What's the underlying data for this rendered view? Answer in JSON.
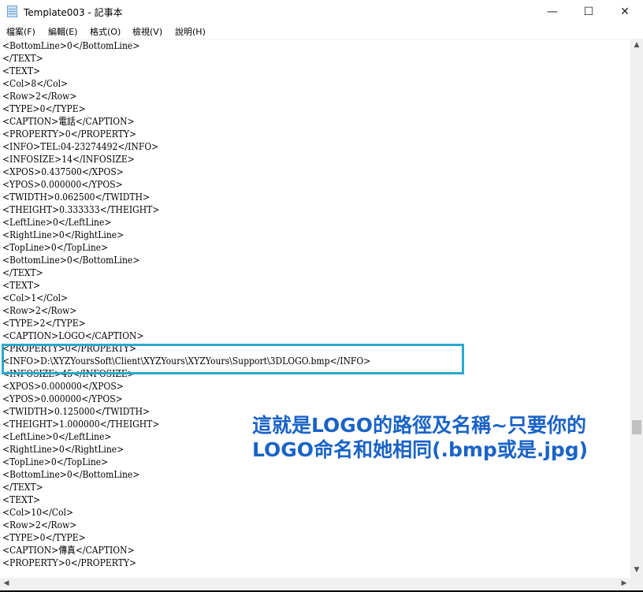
{
  "window": {
    "title": "Template003 - 記事本",
    "controls": {
      "minimize": "—",
      "maximize": "☐",
      "close": "✕"
    }
  },
  "menu": [
    "檔案(F)",
    "編輯(E)",
    "格式(O)",
    "檢視(V)",
    "說明(H)"
  ],
  "lines": [
    "<BottomLine>0</BottomLine>",
    "</TEXT>",
    "<TEXT>",
    "<Col>8</Col>",
    "<Row>2</Row>",
    "<TYPE>0</TYPE>",
    "<CAPTION>電話</CAPTION>",
    "<PROPERTY>0</PROPERTY>",
    "<INFO>TEL:04-23274492</INFO>",
    "<INFOSIZE>14</INFOSIZE>",
    "<XPOS>0.437500</XPOS>",
    "<YPOS>0.000000</YPOS>",
    "<TWIDTH>0.062500</TWIDTH>",
    "<THEIGHT>0.333333</THEIGHT>",
    "<LeftLine>0</LeftLine>",
    "<RightLine>0</RightLine>",
    "<TopLine>0</TopLine>",
    "<BottomLine>0</BottomLine>",
    "</TEXT>",
    "<TEXT>",
    "<Col>1</Col>",
    "<Row>2</Row>",
    "<TYPE>2</TYPE>",
    "<CAPTION>LOGO</CAPTION>",
    "<PROPERTY>0</PROPERTY>",
    "<INFO>D:\\XYZYoursSoft\\Client\\XYZYours\\XYZYours\\Support\\3DLOGO.bmp</INFO>",
    "<INFOSIZE>45</INFOSIZE>",
    "<XPOS>0.000000</XPOS>",
    "<YPOS>0.000000</YPOS>",
    "<TWIDTH>0.125000</TWIDTH>",
    "<THEIGHT>1.000000</THEIGHT>",
    "<LeftLine>0</LeftLine>",
    "<RightLine>0</RightLine>",
    "<TopLine>0</TopLine>",
    "<BottomLine>0</BottomLine>",
    "</TEXT>",
    "<TEXT>",
    "<Col>10</Col>",
    "<Row>2</Row>",
    "<TYPE>0</TYPE>",
    "<CAPTION>傳真</CAPTION>",
    "<PROPERTY>0</PROPERTY>"
  ],
  "annotation": "這就是LOGO的路徑及名稱~只要你的LOGO命名和她相同(.bmp或是.jpg)",
  "colors": {
    "annotation": "#1a63c6",
    "highlight": "#29a9cf"
  }
}
